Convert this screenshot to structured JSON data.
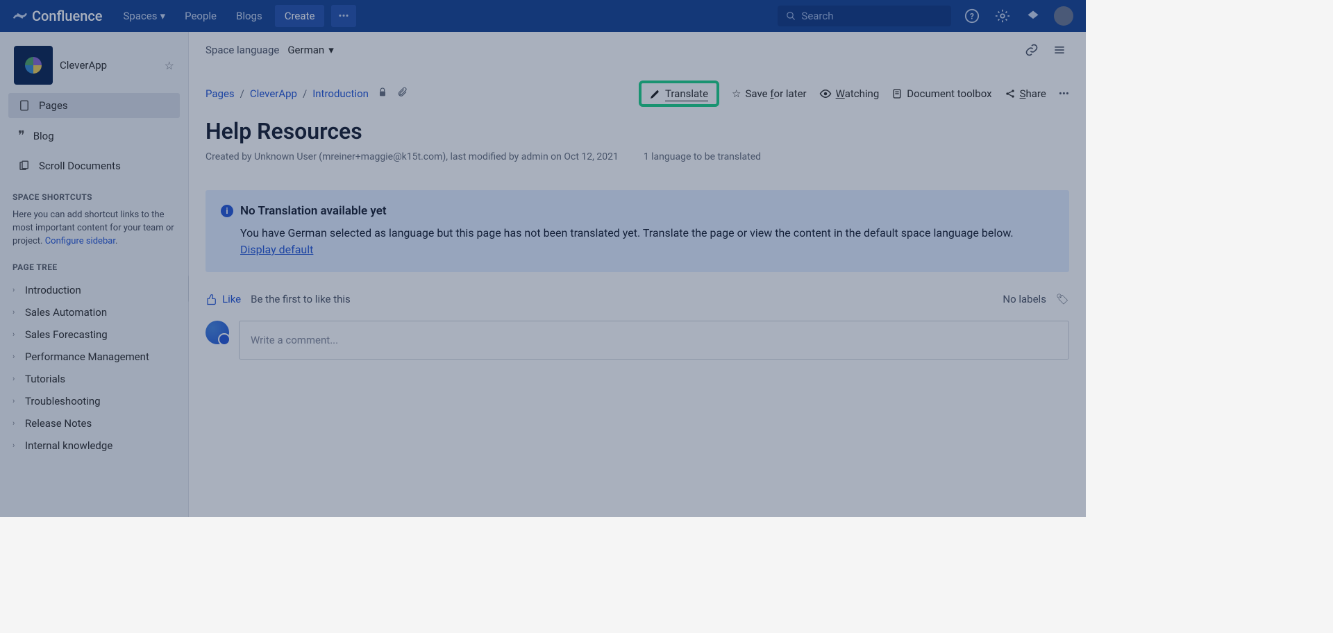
{
  "topbar": {
    "product": "Confluence",
    "nav": {
      "spaces": "Spaces",
      "people": "People",
      "blogs": "Blogs"
    },
    "create": "Create",
    "more": "•••",
    "search_placeholder": "Search"
  },
  "sidebar": {
    "space_name": "CleverApp",
    "items": [
      {
        "icon": "page",
        "label": "Pages",
        "active": true
      },
      {
        "icon": "blog",
        "label": "Blog",
        "active": false
      },
      {
        "icon": "doc",
        "label": "Scroll Documents",
        "active": false
      }
    ],
    "shortcuts_header": "SPACE SHORTCUTS",
    "shortcuts_help_pre": "Here you can add shortcut links to the most important content for your team or project. ",
    "shortcuts_help_link": "Configure sidebar",
    "shortcuts_help_post": ".",
    "tree_header": "PAGE TREE",
    "tree": [
      "Introduction",
      "Sales Automation",
      "Sales Forecasting",
      "Performance Management",
      "Tutorials",
      "Troubleshooting",
      "Release Notes",
      "Internal knowledge"
    ]
  },
  "toolbar1": {
    "label": "Space language",
    "language": "German"
  },
  "breadcrumb": {
    "items": [
      "Pages",
      "CleverApp",
      "Introduction"
    ]
  },
  "actions": {
    "translate": "Translate",
    "save": {
      "pre": "Save ",
      "u": "f",
      "post": "or later"
    },
    "watch": {
      "u": "W",
      "post": "atching"
    },
    "doctool": "Document toolbox",
    "share": {
      "u": "S",
      "post": "hare"
    }
  },
  "page": {
    "title": "Help Resources",
    "meta_author": "Created by Unknown User (mreiner+maggie@k15t.com), last modified by admin on Oct 12, 2021",
    "meta_lang": "1 language to be translated"
  },
  "info": {
    "title": "No Translation available yet",
    "body": "You have German selected as language but this page has not been translated yet. Translate the page or view the content in the default space language below.",
    "link": "Display default"
  },
  "like": {
    "like": "Like",
    "first": "Be the first to like this",
    "nolabels": "No labels"
  },
  "comment": {
    "placeholder": "Write a comment..."
  }
}
